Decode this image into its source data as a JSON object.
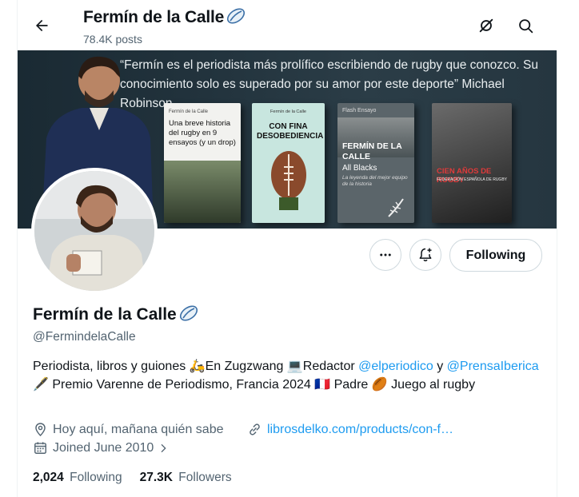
{
  "header": {
    "title": "Fermín de la Calle",
    "posts": "78.4K posts"
  },
  "banner": {
    "quote": "“Fermín es el periodista más prolífico escribiendo de rugby que conozco. Su conocimiento solo es superado por su amor por este deporte” Michael Robinson",
    "books": [
      {
        "top": "Fermín de la Calle",
        "title": "Una breve historia del rugby en 9 ensayos (y un drop)"
      },
      {
        "top": "Fermín de la Calle",
        "title": "CON FINA DESOBEDIENCIA"
      },
      {
        "top": "Flash Ensayo",
        "title": "FERMÍN DE LA CALLE",
        "sub": "All Blacks",
        "tag": "La leyenda del mejor equipo de la historia"
      },
      {
        "title": "CIEN AÑOS DE RUGBY",
        "sub": "FEDERACIÓN ESPAÑOLA DE RUGBY"
      }
    ]
  },
  "actions": {
    "follow_label": "Following"
  },
  "profile": {
    "name": "Fermín de la Calle",
    "handle": "@FermindelaCalle",
    "bio_1": "Periodista, libros y guiones 🛵En Zugzwang 💻Redactor ",
    "bio_mention1": "@elperiodico",
    "bio_2": " y ",
    "bio_mention2": "@PrensaIberica",
    "bio_3": " 🖋️ Premio Varenne de Periodismo, Francia 2024 🇫🇷 Padre 🏉 Juego al rugby",
    "location": "Hoy aquí, mañana quién sabe",
    "url": "librosdelko.com/products/con-f…",
    "joined": "Joined June 2010"
  },
  "stats": {
    "following_count": "2,024",
    "following_label": "Following",
    "followers_count": "27.3K",
    "followers_label": "Followers"
  },
  "colors": {
    "accent": "#1d9bf0",
    "muted": "#536471",
    "text": "#0f1419"
  }
}
